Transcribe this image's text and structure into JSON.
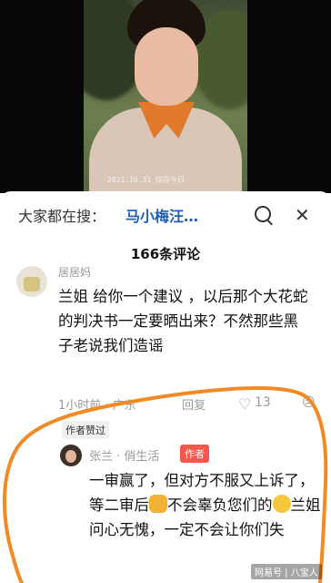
{
  "video": {
    "timestamp": "2021.10.31 保存今日"
  },
  "search": {
    "prefix": "大家都在搜：",
    "term": "马小梅汪…",
    "search_icon": "search-icon",
    "close_icon": "close-icon",
    "close_glyph": "✕"
  },
  "comments_header": {
    "count_label": "166条评论"
  },
  "comment": {
    "username": "居居妈",
    "text": "兰姐 给你一个建议 ，以后那个大花蛇的判决书一定要晒出来？不然那些黑子老说我们造谣",
    "time_location": "1小时前 · 广东",
    "reply_label": "回复",
    "heart_glyph": "♡",
    "likes": "13",
    "dislike_glyph": "☹"
  },
  "reply": {
    "liked_tag": "作者赞过",
    "username": "张兰 · 俏生活",
    "author_badge": "作者",
    "text_part1": "一审赢了，但对方不服又上诉了，等二审后",
    "text_part2": "不会辜负您们的",
    "text_part3": "兰姐问心无愧，一定不会让你们失"
  },
  "watermark": "网易号 | 八宝人",
  "colors": {
    "link_blue": "#1f5fb6",
    "author_badge_red": "#f1574d",
    "highlight_orange": "#f08a24"
  }
}
